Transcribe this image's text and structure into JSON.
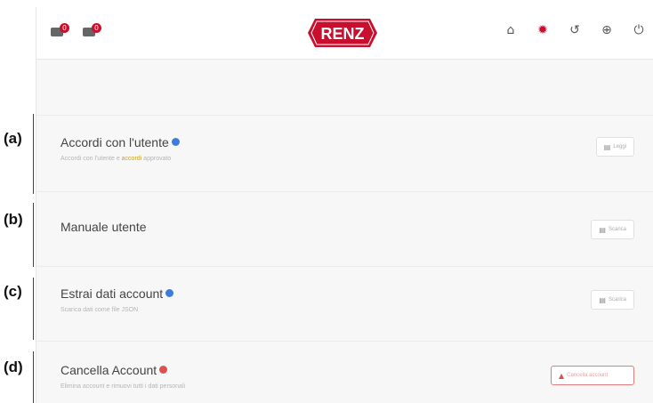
{
  "header": {
    "brand": "RENZ",
    "left_icons": [
      {
        "name": "parcel-box-icon",
        "badge": "0"
      },
      {
        "name": "parcel-box-icon",
        "badge": "0"
      }
    ],
    "right_icons": [
      {
        "name": "home-icon",
        "glyph": "⌂"
      },
      {
        "name": "gear-icon",
        "glyph": "✹"
      },
      {
        "name": "history-icon",
        "glyph": "↺"
      },
      {
        "name": "globe-icon",
        "glyph": "⊕"
      },
      {
        "name": "power-icon",
        "glyph": "⏻"
      }
    ],
    "accent_color": "#c8102e"
  },
  "labels": {
    "a": "(a)",
    "b": "(b)",
    "c": "(c)",
    "d": "(d)"
  },
  "rows": {
    "user_agreements": {
      "title": "Accordi con l'utente",
      "subtitle_pre": "Accordi con l'utente e ",
      "subtitle_hl": "accordi",
      "subtitle_post": " approvato",
      "button_label": "Leggi"
    },
    "user_manual": {
      "title": "Manuale utente",
      "button_label": "Scarica"
    },
    "extract_data": {
      "title": "Estrai dati account",
      "subtitle": "Scarica dati come file JSON",
      "button_label": "Scarica"
    },
    "delete_account": {
      "title": "Cancella Account",
      "subtitle": "Elimina account e rimuovi tutti i dati personali",
      "button_label": "Cancella account"
    }
  }
}
